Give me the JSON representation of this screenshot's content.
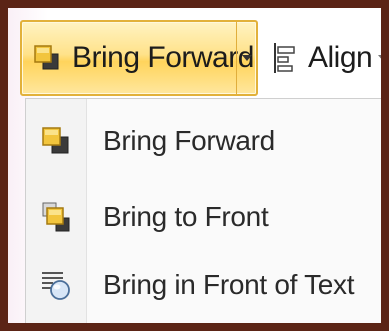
{
  "ribbon": {
    "bring_forward_label": "Bring Forward",
    "align_label": "Align"
  },
  "menu": {
    "items": [
      {
        "label": "Bring Forward",
        "icon": "bring-forward-icon"
      },
      {
        "label": "Bring to Front",
        "icon": "bring-to-front-icon"
      },
      {
        "label": "Bring in Front of Text",
        "icon": "bring-in-front-of-text-icon"
      }
    ]
  },
  "colors": {
    "frame_border": "#5b2416",
    "button_highlight": "#ffd45c",
    "button_border": "#e2b13a",
    "menu_background": "#fafafa"
  }
}
